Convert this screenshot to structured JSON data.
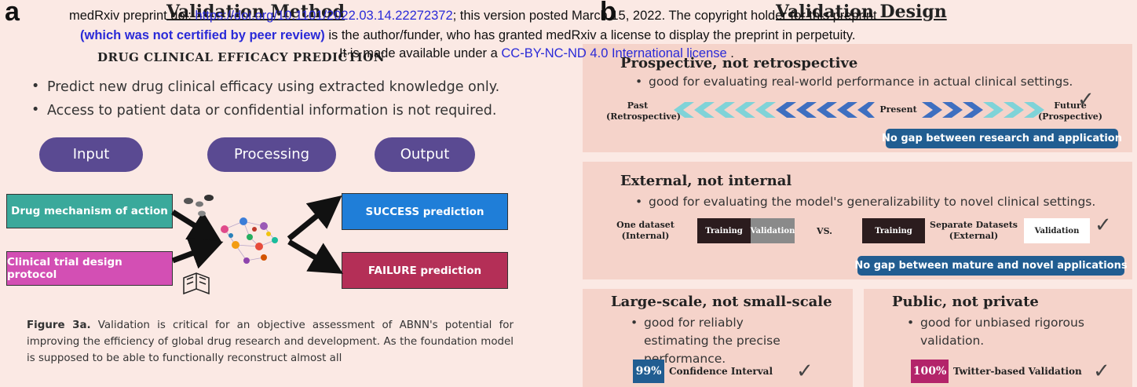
{
  "panels": {
    "a": "a",
    "b": "b"
  },
  "left": {
    "title": "Validation Method",
    "subtitle": "DRUG CLINICAL EFFICACY PREDICTION",
    "bullets": [
      "Predict new drug clinical efficacy using extracted knowledge only.",
      "Access to patient data or confidential information is not required."
    ],
    "stages": {
      "input": "Input",
      "processing": "Processing",
      "output": "Output"
    },
    "inputs": [
      "Drug mechanism of action",
      "Clinical trial design protocol"
    ],
    "outputs": [
      "SUCCESS prediction",
      "FAILURE prediction"
    ],
    "colors": {
      "teal": "#3aa99b",
      "magenta": "#d34fb4",
      "blue": "#1f7ed8",
      "crimson": "#b42f57",
      "purple": "#5a4a92"
    },
    "caption_label": "Figure 3a.",
    "caption_text": "Validation is critical for an objective assessment of ABNN's potential for improving the efficiency of global drug research and development. As the foundation model is supposed to be able to functionally reconstruct almost all"
  },
  "right": {
    "title": "Validation Design",
    "prospective": {
      "title": "Prospective, not retrospective",
      "bullet": "good for evaluating real-world performance in actual clinical settings.",
      "past": "Past",
      "past_sub": "(Retrospective)",
      "present": "Present",
      "future": "Future",
      "future_sub": "(Prospective)",
      "badge": "No gap between research and application"
    },
    "external": {
      "title": "External, not internal",
      "bullet": "good for evaluating the model's generalizability to novel clinical settings.",
      "one_dataset": "One dataset",
      "internal": "(Internal)",
      "training": "Training",
      "validation": "Validation",
      "vs": "VS.",
      "separate": "Separate Datasets",
      "external_label": "(External)",
      "badge": "No gap between mature and novel applications"
    },
    "large": {
      "title": "Large-scale, not small-scale",
      "bullet": "good for reliably estimating the precise performance.",
      "percent": "99%",
      "label": "Confidence Interval"
    },
    "public": {
      "title": "Public, not private",
      "bullet": "good for unbiased rigorous validation.",
      "percent": "100%",
      "label": "Twitter-based Validation"
    }
  },
  "overlay": {
    "line1_a": "medRxiv preprint doi: ",
    "line1_link": "https://doi.org/10.1101/2022.03.14.22272372",
    "line1_b": "; this version posted March 15, 2022. The copyright holder for this preprint",
    "line2_bold": "(which was not certified by peer review)",
    "line2_rest": " is the author/funder, who has granted medRxiv a license to display the preprint in perpetuity.",
    "line3_a": "It is made available under a ",
    "line3_link": "CC-BY-NC-ND 4.0 International license",
    "line3_b": " ."
  }
}
